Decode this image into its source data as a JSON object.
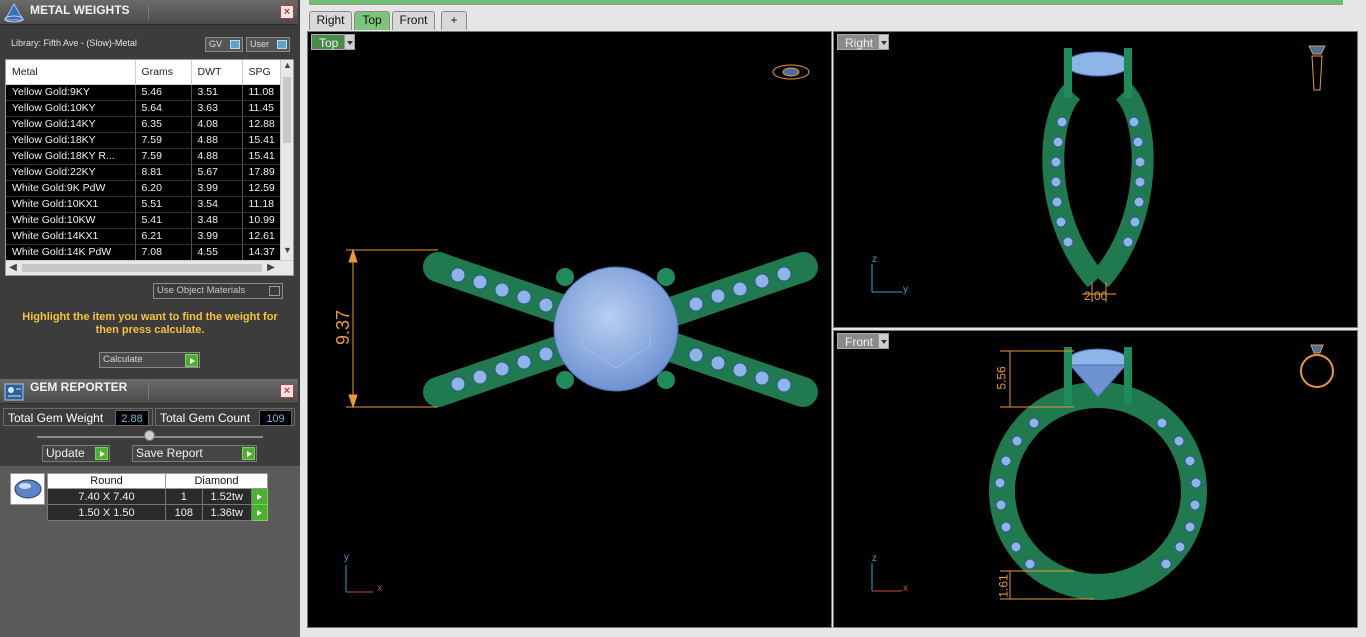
{
  "metal_weights": {
    "title": "METAL WEIGHTS",
    "library_label": "Library: Fifth Ave - (Slow)-Metal",
    "toggle_gv": "GV",
    "toggle_user": "User",
    "columns": [
      "Metal",
      "Grams",
      "DWT",
      "SPG"
    ],
    "rows": [
      [
        "Yellow Gold:9KY",
        "5.46",
        "3.51",
        "11.08"
      ],
      [
        "Yellow Gold:10KY",
        "5.64",
        "3.63",
        "11.45"
      ],
      [
        "Yellow Gold:14KY",
        "6.35",
        "4.08",
        "12.88"
      ],
      [
        "Yellow Gold:18KY",
        "7.59",
        "4.88",
        "15.41"
      ],
      [
        "Yellow Gold:18KY R...",
        "7.59",
        "4.88",
        "15.41"
      ],
      [
        "Yellow Gold:22KY",
        "8.81",
        "5.67",
        "17.89"
      ],
      [
        "White Gold:9K PdW",
        "6.20",
        "3.99",
        "12.59"
      ],
      [
        "White Gold:10KX1",
        "5.51",
        "3.54",
        "11.18"
      ],
      [
        "White Gold:10KW",
        "5.41",
        "3.48",
        "10.99"
      ],
      [
        "White Gold:14KX1",
        "6.21",
        "3.99",
        "12.61"
      ],
      [
        "White Gold:14K PdW",
        "7.08",
        "4.55",
        "14.37"
      ]
    ],
    "use_object_materials": "Use Object Materials",
    "hint": "Highlight the item you want to find the weight for then press calculate.",
    "calculate_label": "Calculate"
  },
  "gem_reporter": {
    "title": "GEM REPORTER",
    "total_weight_label": "Total Gem Weight",
    "total_weight_value": "2.88",
    "total_count_label": "Total Gem Count",
    "total_count_value": "109",
    "update_label": "Update",
    "save_report_label": "Save Report",
    "shape_header": "Round",
    "material_header": "Diamond",
    "rows": [
      {
        "size": "7.40 X 7.40",
        "count": "1",
        "weight": "1.52tw"
      },
      {
        "size": "1.50 X 1.50",
        "count": "108",
        "weight": "1.36tw"
      }
    ]
  },
  "tabs": [
    "Right",
    "Top",
    "Front",
    "+"
  ],
  "active_tab": "Top",
  "viewports": {
    "top": {
      "label": "Top",
      "dimension": "9.37",
      "axis_y": "y",
      "axis_x": "x"
    },
    "right": {
      "label": "Right",
      "dimension": "2.00",
      "axis_z": "z",
      "axis_y": "y"
    },
    "front": {
      "label": "Front",
      "dimension_top": "5.56",
      "dimension_bottom": "1.61",
      "axis_z": "z",
      "axis_x": "x"
    }
  },
  "colors": {
    "metal_green": "#1f7a4f",
    "gem_blue": "#8fb4e8",
    "dimension_orange": "#e89a3a",
    "active_tab": "#7dc47d"
  }
}
